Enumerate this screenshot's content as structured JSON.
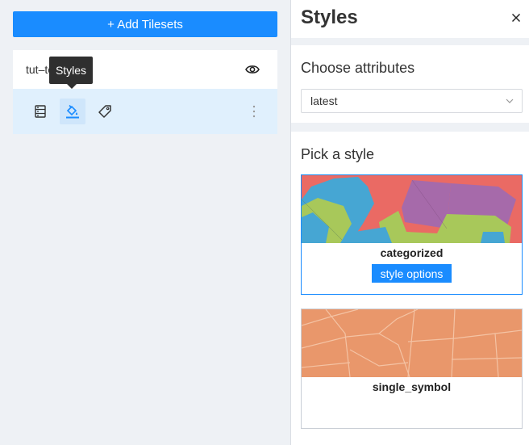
{
  "left": {
    "add_button": "+ Add Tilesets",
    "tileset": {
      "name": "tut–te",
      "tooltip": "Styles",
      "tools": [
        "list-icon",
        "paint-bucket-icon",
        "tag-icon"
      ]
    }
  },
  "right": {
    "title": "Styles",
    "choose_attributes": {
      "heading": "Choose attributes",
      "selected": "latest"
    },
    "pick_style": {
      "heading": "Pick a style",
      "styles": [
        {
          "name": "categorized",
          "options_label": "style options",
          "selected": true
        },
        {
          "name": "single_symbol",
          "selected": false
        }
      ]
    }
  },
  "colors": {
    "accent": "#1a8cff",
    "panel_bg": "#eef1f5",
    "tools_bg": "#e0f0fd",
    "map_red": "#ea6a64",
    "map_blue": "#46a6d3",
    "map_green": "#a8c85a",
    "map_purple": "#a66aaa",
    "map_orange": "#e9976b"
  }
}
